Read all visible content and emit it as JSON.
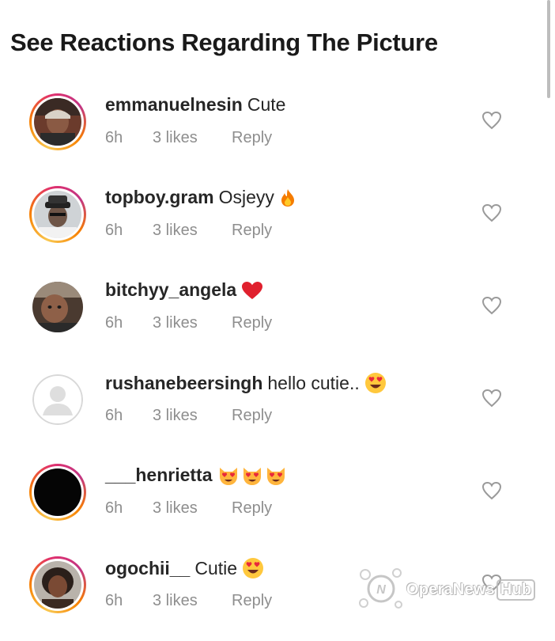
{
  "headline": "See Reactions Regarding The Picture",
  "colors": {
    "text": "#262626",
    "meta": "#8e8e8e",
    "heart": "#e0245e",
    "ring": "#e1306c"
  },
  "comments": [
    {
      "username": "emmanuelnesin",
      "text": "Cute",
      "emoji": [],
      "time": "6h",
      "likes": "3 likes",
      "reply": "Reply",
      "avatar": "photo-man-cap",
      "story_ring": true
    },
    {
      "username": "topboy.gram",
      "text": "Osjeyy",
      "emoji": [
        "fire-emoji"
      ],
      "time": "6h",
      "likes": "3 likes",
      "reply": "Reply",
      "avatar": "photo-man-hat",
      "story_ring": true
    },
    {
      "username": "bitchyy_angela",
      "text": "",
      "emoji": [
        "red-heart-emoji"
      ],
      "time": "6h",
      "likes": "3 likes",
      "reply": "Reply",
      "avatar": "photo-baby",
      "story_ring": false
    },
    {
      "username": "rushanebeersingh",
      "text": "hello cutie..",
      "emoji": [
        "heart-eyes-emoji"
      ],
      "time": "6h",
      "likes": "3 likes",
      "reply": "Reply",
      "avatar": "default-avatar",
      "story_ring": false
    },
    {
      "username": "___henrietta",
      "text": "",
      "emoji": [
        "heart-eyes-cat-emoji",
        "heart-eyes-cat-emoji",
        "heart-eyes-cat-emoji"
      ],
      "time": "6h",
      "likes": "3 likes",
      "reply": "Reply",
      "avatar": "black-avatar",
      "story_ring": true
    },
    {
      "username": "ogochii__",
      "text": "Cutie",
      "emoji": [
        "heart-eyes-emoji"
      ],
      "time": "6h",
      "likes": "3 likes",
      "reply": "Reply",
      "avatar": "photo-woman",
      "story_ring": true
    }
  ],
  "watermark": {
    "name": "OperaNews",
    "suffix": "Hub"
  }
}
